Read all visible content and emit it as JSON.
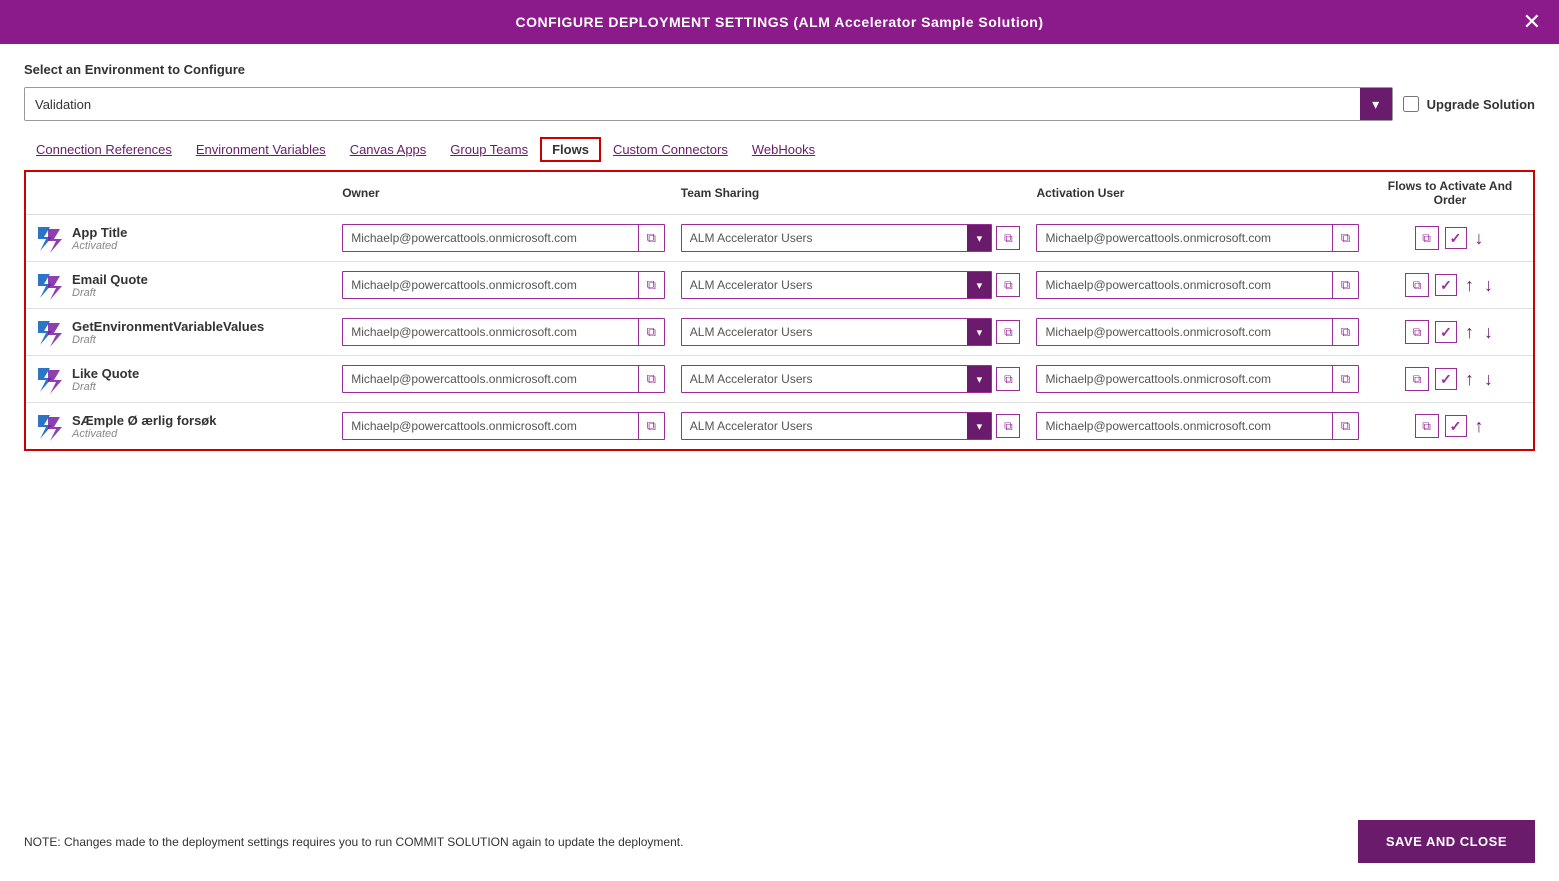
{
  "header": {
    "title": "CONFIGURE DEPLOYMENT SETTINGS (ALM Accelerator Sample Solution)",
    "close_label": "✕"
  },
  "env_section": {
    "label": "Select an Environment to Configure",
    "selected_env": "Validation",
    "dropdown_icon": "▾",
    "upgrade_solution_label": "Upgrade Solution",
    "upgrade_checked": false
  },
  "tabs": [
    {
      "id": "connection-references",
      "label": "Connection References"
    },
    {
      "id": "environment-variables",
      "label": "Environment Variables"
    },
    {
      "id": "canvas-apps",
      "label": "Canvas Apps"
    },
    {
      "id": "group-teams",
      "label": "Group Teams"
    },
    {
      "id": "flows",
      "label": "Flows",
      "active": true
    },
    {
      "id": "custom-connectors",
      "label": "Custom Connectors"
    },
    {
      "id": "webhooks",
      "label": "WebHooks"
    }
  ],
  "table": {
    "headers": {
      "flow": "",
      "owner": "Owner",
      "team_sharing": "Team Sharing",
      "activation_user": "Activation User",
      "flows_order": "Flows to Activate And Order"
    },
    "rows": [
      {
        "name": "App Title",
        "status": "Activated",
        "owner": "Michaelp@powercattools.onmicrosoft.com",
        "team_sharing": "ALM Accelerator Users",
        "activation_user": "Michaelp@powercattools.onmicrosoft.com",
        "checked": true,
        "has_up": false,
        "has_down": true
      },
      {
        "name": "Email Quote",
        "status": "Draft",
        "owner": "Michaelp@powercattools.onmicrosoft.com",
        "team_sharing": "ALM Accelerator Users",
        "activation_user": "Michaelp@powercattools.onmicrosoft.com",
        "checked": true,
        "has_up": true,
        "has_down": true
      },
      {
        "name": "GetEnvironmentVariableValues",
        "status": "Draft",
        "owner": "Michaelp@powercattools.onmicrosoft.com",
        "team_sharing": "ALM Accelerator Users",
        "activation_user": "Michaelp@powercattools.onmicrosoft.com",
        "checked": true,
        "has_up": true,
        "has_down": true
      },
      {
        "name": "Like Quote",
        "status": "Draft",
        "owner": "Michaelp@powercattools.onmicrosoft.com",
        "team_sharing": "ALM Accelerator Users",
        "activation_user": "Michaelp@powercattools.onmicrosoft.com",
        "checked": true,
        "has_up": true,
        "has_down": true
      },
      {
        "name": "SÆmple Ø ærlig forsøk",
        "status": "Activated",
        "owner": "Michaelp@powercattools.onmicrosoft.com",
        "team_sharing": "ALM Accelerator Users",
        "activation_user": "Michaelp@powercattools.onmicrosoft.com",
        "checked": true,
        "has_up": true,
        "has_down": false
      }
    ]
  },
  "footer": {
    "note": "NOTE: Changes made to the deployment settings requires you to run COMMIT SOLUTION again to update the deployment.",
    "save_close": "SAVE AND CLOSE"
  }
}
